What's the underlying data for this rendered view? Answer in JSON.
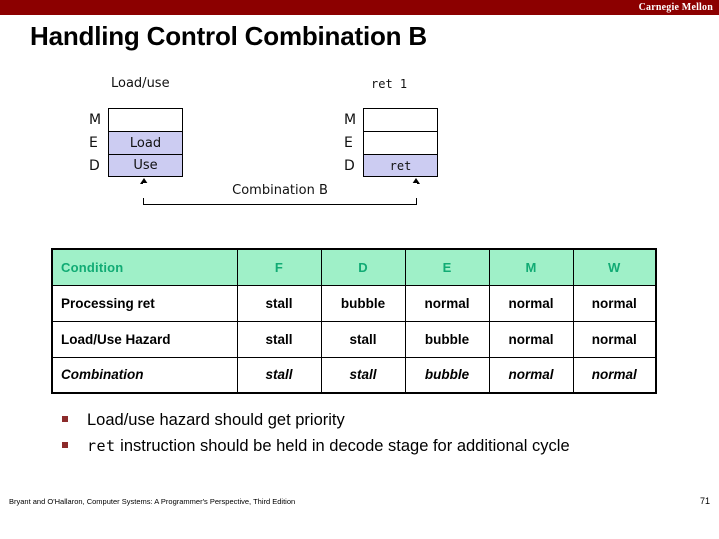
{
  "banner": {
    "brand": "Carnegie Mellon"
  },
  "title": "Handling Control Combination B",
  "diagram": {
    "left_group": {
      "caption": "Load/use",
      "rows": [
        {
          "stage": "M",
          "text": "",
          "filled": false
        },
        {
          "stage": "E",
          "text": "Load",
          "filled": true
        },
        {
          "stage": "D",
          "text": "Use",
          "filled": true
        }
      ]
    },
    "right_group": {
      "caption": "ret 1",
      "rows": [
        {
          "stage": "M",
          "text": "",
          "filled": false
        },
        {
          "stage": "E",
          "text": "",
          "filled": false
        },
        {
          "stage": "D",
          "text": "ret",
          "filled": true
        }
      ]
    },
    "connector_label": "Combination B"
  },
  "table": {
    "headers": [
      "Condition",
      "F",
      "D",
      "E",
      "M",
      "W"
    ],
    "rows": [
      {
        "condition": "Processing ret",
        "values": [
          "stall",
          "bubble",
          "normal",
          "normal",
          "normal"
        ],
        "italic": false
      },
      {
        "condition": "Load/Use Hazard",
        "values": [
          "stall",
          "stall",
          "bubble",
          "normal",
          "normal"
        ],
        "italic": false
      },
      {
        "condition": "Combination",
        "values": [
          "stall",
          "stall",
          "bubble",
          "normal",
          "normal"
        ],
        "italic": true
      }
    ]
  },
  "bullets": [
    {
      "prefix": "",
      "code": "",
      "text": "Load/use hazard should get priority"
    },
    {
      "prefix": "",
      "code": "ret",
      "text": " instruction should be held in decode stage for additional cycle"
    }
  ],
  "footer": {
    "citation": "Bryant and O'Hallaron, Computer Systems: A Programmer's Perspective, Third Edition",
    "page_number": "71"
  },
  "colors": {
    "banner_red": "#8c0000",
    "stage_fill": "#ccccf2",
    "table_header_bg": "#9ff0c8",
    "table_header_text": "#11ab74",
    "bullet_marker": "#8c2b2b"
  }
}
